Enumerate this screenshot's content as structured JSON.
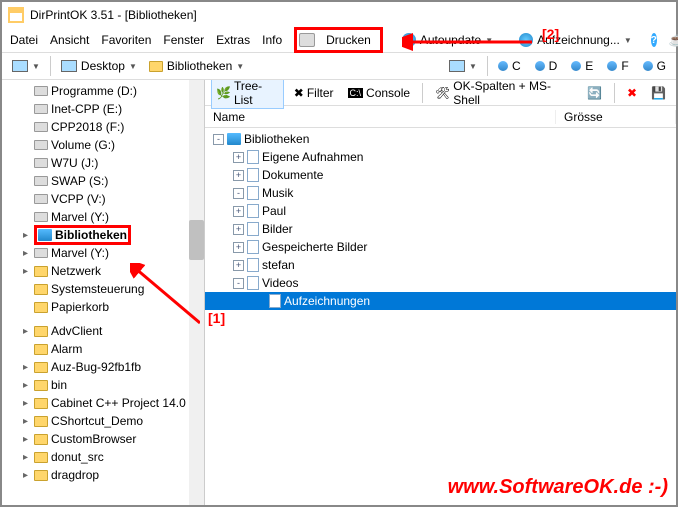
{
  "title": "DirPrintOK 3.51 - [Bibliotheken]",
  "menu": {
    "datei": "Datei",
    "ansicht": "Ansicht",
    "favoriten": "Favoriten",
    "fenster": "Fenster",
    "extras": "Extras",
    "info": "Info",
    "drucken": "Drucken",
    "autoupdate": "Autoupdate",
    "aufzeichnung": "Aufzeichnung..."
  },
  "breadcrumb": {
    "desktop": "Desktop",
    "biblio": "Bibliotheken"
  },
  "drives": [
    "C",
    "D",
    "E",
    "F",
    "G"
  ],
  "left_tree": [
    {
      "i": 2,
      "t": "drive",
      "label": "Programme (D:)"
    },
    {
      "i": 2,
      "t": "drive",
      "label": "Inet-CPP (E:)"
    },
    {
      "i": 2,
      "t": "drive",
      "label": "CPP2018 (F:)"
    },
    {
      "i": 2,
      "t": "drive",
      "label": "Volume (G:)"
    },
    {
      "i": 2,
      "t": "drive",
      "label": "W7U (J:)"
    },
    {
      "i": 2,
      "t": "drive",
      "label": "SWAP (S:)"
    },
    {
      "i": 2,
      "t": "drive",
      "label": "VCPP (V:)"
    },
    {
      "i": 2,
      "t": "drive",
      "label": "Marvel (Y:)"
    },
    {
      "i": 1,
      "t": "lib",
      "label": "Bibliotheken",
      "hl": true,
      "tw": "▸"
    },
    {
      "i": 1,
      "t": "drive",
      "label": "Marvel (Y:)",
      "tw": "▸"
    },
    {
      "i": 1,
      "t": "net",
      "label": "Netzwerk",
      "tw": "▸"
    },
    {
      "i": 1,
      "t": "sys",
      "label": "Systemsteuerung"
    },
    {
      "i": 1,
      "t": "bin",
      "label": "Papierkorb"
    },
    {
      "i": 1,
      "t": "spacer",
      "label": ""
    },
    {
      "i": 2,
      "t": "folder",
      "label": "AdvClient",
      "tw": "▸"
    },
    {
      "i": 2,
      "t": "folder",
      "label": "Alarm"
    },
    {
      "i": 2,
      "t": "folder",
      "label": "Auz-Bug-92fb1fb",
      "tw": "▸"
    },
    {
      "i": 2,
      "t": "folder",
      "label": "bin",
      "tw": "▸"
    },
    {
      "i": 2,
      "t": "folder",
      "label": "Cabinet C++ Project 14.0",
      "tw": "▸"
    },
    {
      "i": 2,
      "t": "folder",
      "label": "CShortcut_Demo",
      "tw": "▸"
    },
    {
      "i": 2,
      "t": "folder",
      "label": "CustomBrowser",
      "tw": "▸"
    },
    {
      "i": 2,
      "t": "folder",
      "label": "donut_src",
      "tw": "▸"
    },
    {
      "i": 2,
      "t": "folder",
      "label": "dragdrop",
      "tw": "▸"
    }
  ],
  "right_toolbar": {
    "treelist": "Tree-List",
    "filter": "Filter",
    "console": "Console",
    "okspalten": "OK-Spalten + MS-Shell"
  },
  "columns": {
    "name": "Name",
    "groesse": "Grösse"
  },
  "right_tree": [
    {
      "ind": 0,
      "exp": "-",
      "t": "lib",
      "label": "Bibliotheken"
    },
    {
      "ind": 1,
      "exp": "+",
      "t": "doc",
      "label": "Eigene Aufnahmen"
    },
    {
      "ind": 1,
      "exp": "+",
      "t": "doc",
      "label": "Dokumente"
    },
    {
      "ind": 1,
      "exp": "-",
      "t": "music",
      "label": "Musik"
    },
    {
      "ind": 1,
      "exp": "+",
      "t": "doc",
      "label": "Paul"
    },
    {
      "ind": 1,
      "exp": "+",
      "t": "doc",
      "label": "Bilder"
    },
    {
      "ind": 1,
      "exp": "+",
      "t": "doc",
      "label": "Gespeicherte Bilder"
    },
    {
      "ind": 1,
      "exp": "+",
      "t": "doc",
      "label": "stefan"
    },
    {
      "ind": 1,
      "exp": "-",
      "t": "doc",
      "label": "Videos"
    },
    {
      "ind": 2,
      "exp": "",
      "t": "doc",
      "label": "Aufzeichnungen",
      "sel": true
    }
  ],
  "annot": {
    "a1": "[1]",
    "a2": "[2]"
  },
  "watermark": "www.SoftwareOK.de :-)"
}
